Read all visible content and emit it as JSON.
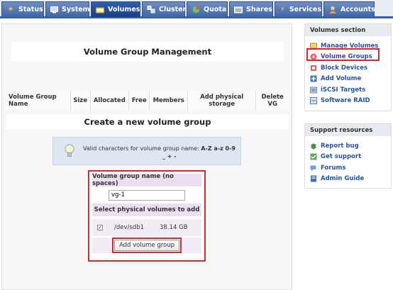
{
  "nav": {
    "tabs": [
      {
        "label": "Status",
        "icon": "status-icon"
      },
      {
        "label": "System",
        "icon": "system-icon"
      },
      {
        "label": "Volumes",
        "icon": "volumes-icon",
        "active": true
      },
      {
        "label": "Cluster",
        "icon": "cluster-icon"
      },
      {
        "label": "Quota",
        "icon": "quota-icon"
      },
      {
        "label": "Shares",
        "icon": "shares-icon"
      },
      {
        "label": "Services",
        "icon": "services-icon"
      },
      {
        "label": "Accounts",
        "icon": "accounts-icon"
      }
    ]
  },
  "main": {
    "title": "Volume Group Management",
    "columns": [
      "Volume Group Name",
      "Size",
      "Allocated",
      "Free",
      "Members",
      "Add physical storage",
      "Delete VG"
    ],
    "create_title": "Create a new volume group",
    "info_prefix": "Valid characters for volume group name: ",
    "info_chars": "A-Z a-z 0-9",
    "info_chars2": "_ + -",
    "form": {
      "name_header": "Volume group name (no spaces)",
      "name_value": "vg-1",
      "pv_header": "Select physical volumes to add",
      "device": "/dev/sdb1",
      "device_size": "38.14 GB",
      "device_checked": true,
      "submit_label": "Add volume group"
    }
  },
  "sidebar": {
    "volumes_section": {
      "title": "Volumes section",
      "items": [
        {
          "label": "Manage Volumes",
          "icon": "manage-volumes-icon"
        },
        {
          "label": "Volume Groups",
          "icon": "volume-groups-icon"
        },
        {
          "label": "Block Devices",
          "icon": "block-devices-icon"
        },
        {
          "label": "Add Volume",
          "icon": "add-volume-icon"
        },
        {
          "label": "iSCSI Targets",
          "icon": "iscsi-targets-icon"
        },
        {
          "label": "Software RAID",
          "icon": "software-raid-icon"
        }
      ]
    },
    "support": {
      "title": "Support resources",
      "items": [
        {
          "label": "Report bug",
          "icon": "report-bug-icon"
        },
        {
          "label": "Get support",
          "icon": "get-support-icon"
        },
        {
          "label": "Forums",
          "icon": "forums-icon"
        },
        {
          "label": "Admin Guide",
          "icon": "admin-guide-icon"
        }
      ]
    }
  },
  "colors": {
    "nav_tab": "#41659f",
    "nav_active": "#1d3f80",
    "link": "#2453a6",
    "highlight": "#d32a2a"
  }
}
